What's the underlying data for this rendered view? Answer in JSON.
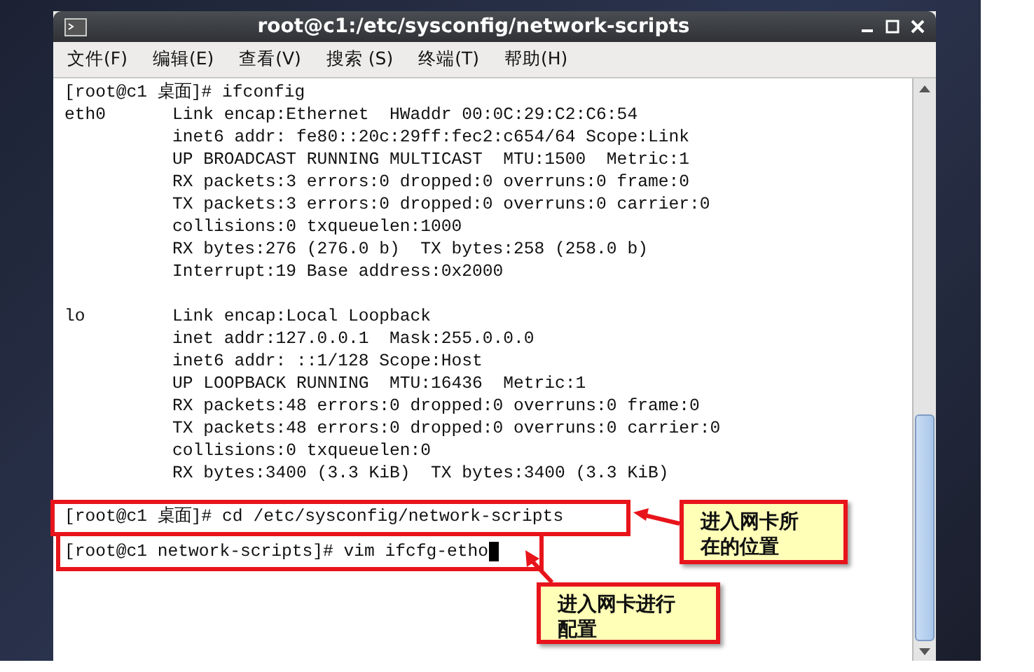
{
  "window": {
    "title": "root@c1:/etc/sysconfig/network-scripts"
  },
  "menu": [
    "文件(F)",
    "编辑(E)",
    "查看(V)",
    "搜索 (S)",
    "终端(T)",
    "帮助(H)"
  ],
  "terminal": [
    {
      "kind": "prompt",
      "text": "[root@c1 桌面]# ifconfig"
    },
    {
      "kind": "interface",
      "label": "eth0",
      "lines": [
        "Link encap:Ethernet  HWaddr 00:0C:29:C2:C6:54",
        "inet6 addr: fe80::20c:29ff:fec2:c654/64 Scope:Link",
        "UP BROADCAST RUNNING MULTICAST  MTU:1500  Metric:1",
        "RX packets:3 errors:0 dropped:0 overruns:0 frame:0",
        "TX packets:3 errors:0 dropped:0 overruns:0 carrier:0",
        "collisions:0 txqueuelen:1000",
        "RX bytes:276 (276.0 b)  TX bytes:258 (258.0 b)",
        "Interrupt:19 Base address:0x2000"
      ]
    },
    {
      "kind": "interface",
      "label": "lo",
      "lines": [
        "Link encap:Local Loopback",
        "inet addr:127.0.0.1  Mask:255.0.0.0",
        "inet6 addr: ::1/128 Scope:Host",
        "UP LOOPBACK RUNNING  MTU:16436  Metric:1",
        "RX packets:48 errors:0 dropped:0 overruns:0 frame:0",
        "TX packets:48 errors:0 dropped:0 overruns:0 carrier:0",
        "collisions:0 txqueuelen:0",
        "RX bytes:3400 (3.3 KiB)  TX bytes:3400 (3.3 KiB)"
      ]
    },
    {
      "kind": "command",
      "text": "[root@c1 桌面]# cd /etc/sysconfig/network-scripts"
    },
    {
      "kind": "command",
      "text": "[root@c1 network-scripts]# vim ifcfg-etho",
      "cursor": true
    }
  ],
  "callouts": [
    "进入网卡所在的位置",
    "进入网卡进行配置"
  ]
}
